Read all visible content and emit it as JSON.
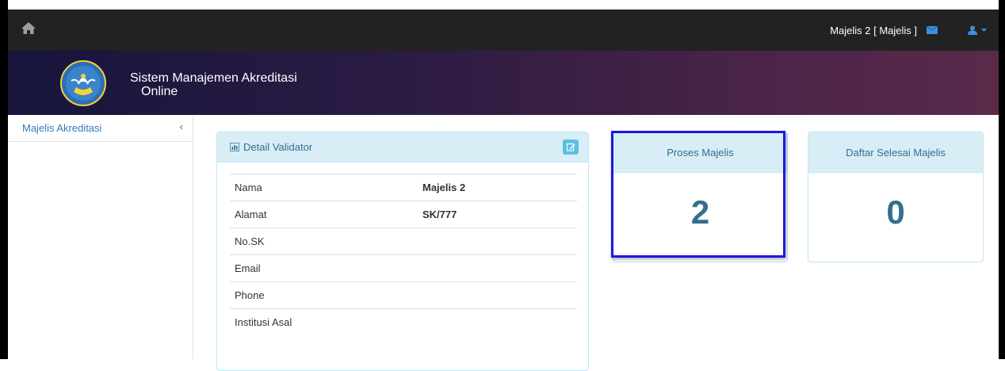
{
  "topbar": {
    "home_icon": "home-icon",
    "user_label": "Majelis 2 [ Majelis ]",
    "mail_icon": "envelope-icon",
    "user_menu_icon": "user-icon"
  },
  "banner": {
    "title_line1": "Sistem Manajemen Akreditasi",
    "title_line2": "Online",
    "logo": "tut-wuri-handayani-logo"
  },
  "sidebar": {
    "items": [
      {
        "label": "Majelis Akreditasi",
        "chevron": "‹"
      }
    ]
  },
  "detail_panel": {
    "title": "Detail Validator",
    "rows": [
      {
        "label": "Nama",
        "value": "Majelis 2"
      },
      {
        "label": "Alamat",
        "value": "SK/777"
      },
      {
        "label": "No.SK",
        "value": ""
      },
      {
        "label": "Email",
        "value": ""
      },
      {
        "label": "Phone",
        "value": ""
      },
      {
        "label": "Institusi Asal",
        "value": ""
      }
    ]
  },
  "stats": [
    {
      "title": "Proses Majelis",
      "value": "2"
    },
    {
      "title": "Daftar Selesai Majelis",
      "value": "0"
    }
  ],
  "colors": {
    "topbar": "#222222",
    "banner_start": "#17153c",
    "banner_end": "#5a2a4a",
    "panel_heading": "#d9edf7",
    "accent_text": "#31708f",
    "highlight_border": "#1a1adf"
  }
}
